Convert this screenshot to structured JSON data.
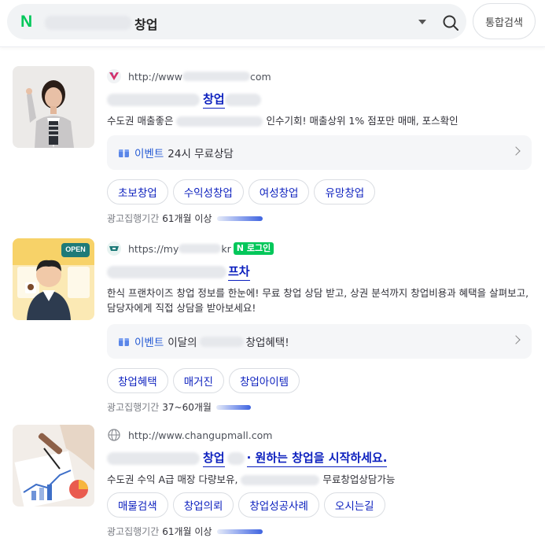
{
  "search": {
    "logo": "N",
    "query": "창업",
    "total_search_label": "통합검색"
  },
  "ads": [
    {
      "url_prefix": "http://www",
      "url_suffix": "com",
      "title": "창업",
      "desc_prefix": "수도권 매출좋은",
      "desc_suffix": "인수기회! 매출상위 1% 점포만 매매, 포스확인",
      "event_label": "이벤트",
      "event_text": "24시 무료상담",
      "tags": [
        "초보창업",
        "수익성창업",
        "여성창업",
        "유망창업"
      ],
      "period_label": "광고집행기간",
      "period_value": "61개월 이상"
    },
    {
      "url_prefix": "https://my",
      "url_suffix": "kr",
      "login_badge": "로그인",
      "title": "프차",
      "desc": "한식 프랜차이즈 창업 정보를 한눈에! 무료 창업 상담 받고, 상권 분석까지 창업비용과 혜택을 살펴보고, 담당자에게 직접 상담을 받아보세요!",
      "event_label": "이벤트",
      "event_prefix": "이달의",
      "event_suffix": "창업혜택!",
      "open_sign": "OPEN",
      "tags": [
        "창업혜택",
        "매거진",
        "창업아이템"
      ],
      "period_label": "광고집행기간",
      "period_value": "37~60개월"
    },
    {
      "url": "http://www.changupmall.com",
      "title_mid": "창업",
      "title_end": "· 원하는 창업을 시작하세요.",
      "desc_prefix": "수도권 수익 A급 매장 다량보유,",
      "desc_suffix": "무료창업상담가능",
      "tags": [
        "매물검색",
        "창업의뢰",
        "창업성공사례",
        "오시는길"
      ],
      "period_label": "광고집행기간",
      "period_value": "61개월 이상"
    }
  ]
}
